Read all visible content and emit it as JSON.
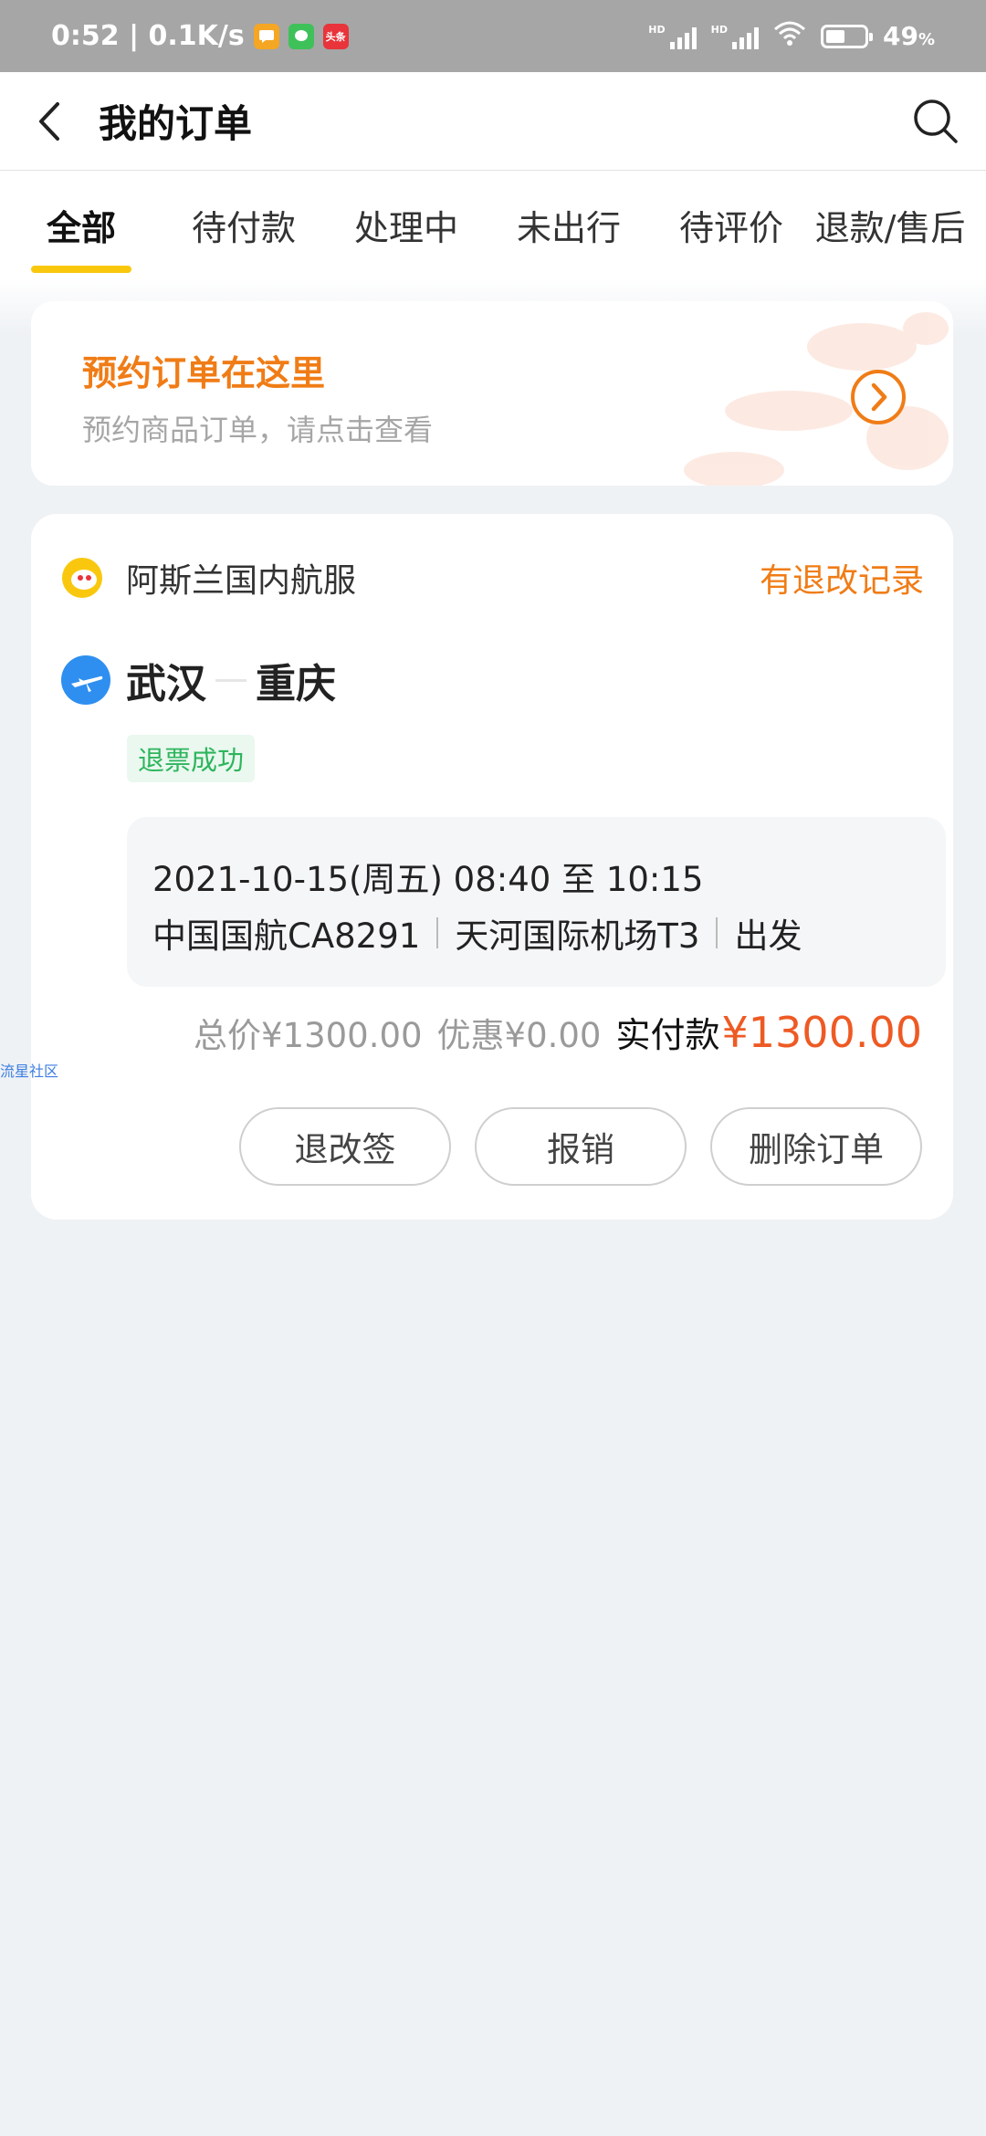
{
  "status_bar": {
    "time_speed": "0:52 | 0.1K/s",
    "app_icons": [
      "message-app-icon",
      "wechat-icon",
      "toutiao-icon"
    ],
    "toutiao_label": "头条",
    "hd1": "HD",
    "hd2": "HD",
    "battery_level": 0.49,
    "battery_text": "49",
    "battery_unit": "%"
  },
  "header": {
    "title": "我的订单",
    "back_icon": "chevron-left-icon",
    "search_icon": "search-icon"
  },
  "tabs": [
    {
      "label": "全部",
      "active": true
    },
    {
      "label": "待付款",
      "active": false
    },
    {
      "label": "处理中",
      "active": false
    },
    {
      "label": "未出行",
      "active": false
    },
    {
      "label": "待评价",
      "active": false
    },
    {
      "label": "退款/售后",
      "active": false
    }
  ],
  "promo": {
    "title": "预约订单在这里",
    "subtitle": "预约商品订单，请点击查看",
    "arrow_icon": "circle-chevron-right-icon"
  },
  "order": {
    "shop_name": "阿斯兰国内航服",
    "record_link": "有退改记录",
    "from_city": "武汉",
    "to_city": "重庆",
    "status": "退票成功",
    "flight_time": "2021-10-15(周五) 08:40 至 10:15",
    "airline_flight": "中国国航CA8291",
    "airport": "天河国际机场T3",
    "direction": "出发",
    "total_price": "总价¥1300.00",
    "discount": "优惠¥0.00",
    "paid_label": "实付款",
    "paid_amount": "¥1300.00",
    "buttons": [
      "退改签",
      "报销",
      "删除订单"
    ]
  },
  "watermark": "流星社区",
  "colors": {
    "accent_orange": "#f07c16",
    "price_red": "#ee5a24",
    "tab_underline": "#f9c80e",
    "success_green": "#2eb55d",
    "background": "#eff2f5"
  }
}
